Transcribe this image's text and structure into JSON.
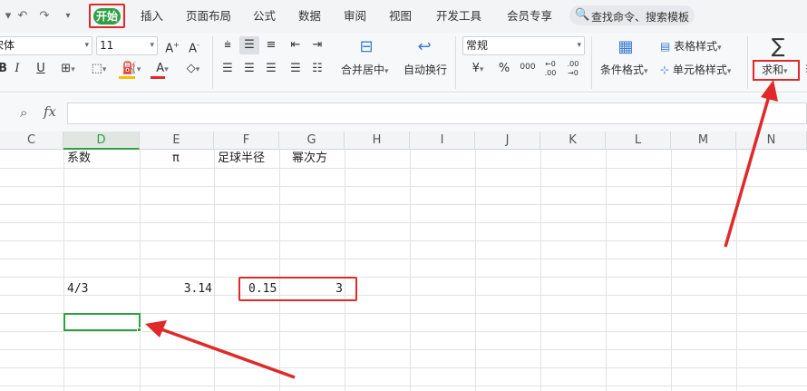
{
  "quick_access": {
    "undo_icon": "↶",
    "redo_icon": "↷",
    "more_icon": "▾"
  },
  "menu": {
    "start": "开始",
    "items": [
      "插入",
      "页面布局",
      "公式",
      "数据",
      "审阅",
      "视图",
      "开发工具",
      "会员专享"
    ],
    "search_placeholder": "查找命令、搜索模板"
  },
  "ribbon": {
    "font_name": "宋体",
    "font_size": "11",
    "number_format": "常规",
    "merge_center": "合并居中",
    "wrap_text": "自动换行",
    "table_style": "表格样式",
    "conditional_format": "条件格式",
    "cell_style": "单元格样式",
    "sum": "求和",
    "sigma": "∑",
    "currency": "¥",
    "percent": "%",
    "thousands": "000",
    "dec_increase": "←0 .00",
    "dec_decrease": ".00 →0"
  },
  "formula_bar": {
    "fx": "fx",
    "value": ""
  },
  "columns": [
    "C",
    "D",
    "E",
    "F",
    "G",
    "H",
    "I",
    "J",
    "K",
    "L",
    "M",
    "N"
  ],
  "active_column": "D",
  "sheet": {
    "headers": {
      "D": "系数",
      "E": "π",
      "F": "足球半径",
      "G": "幂次方"
    },
    "values": {
      "D": "4/3",
      "E": "3.14",
      "F": "0.15",
      "G": "3"
    }
  },
  "colors": {
    "accent": "#2ea043",
    "highlight": "#e02a2a"
  }
}
